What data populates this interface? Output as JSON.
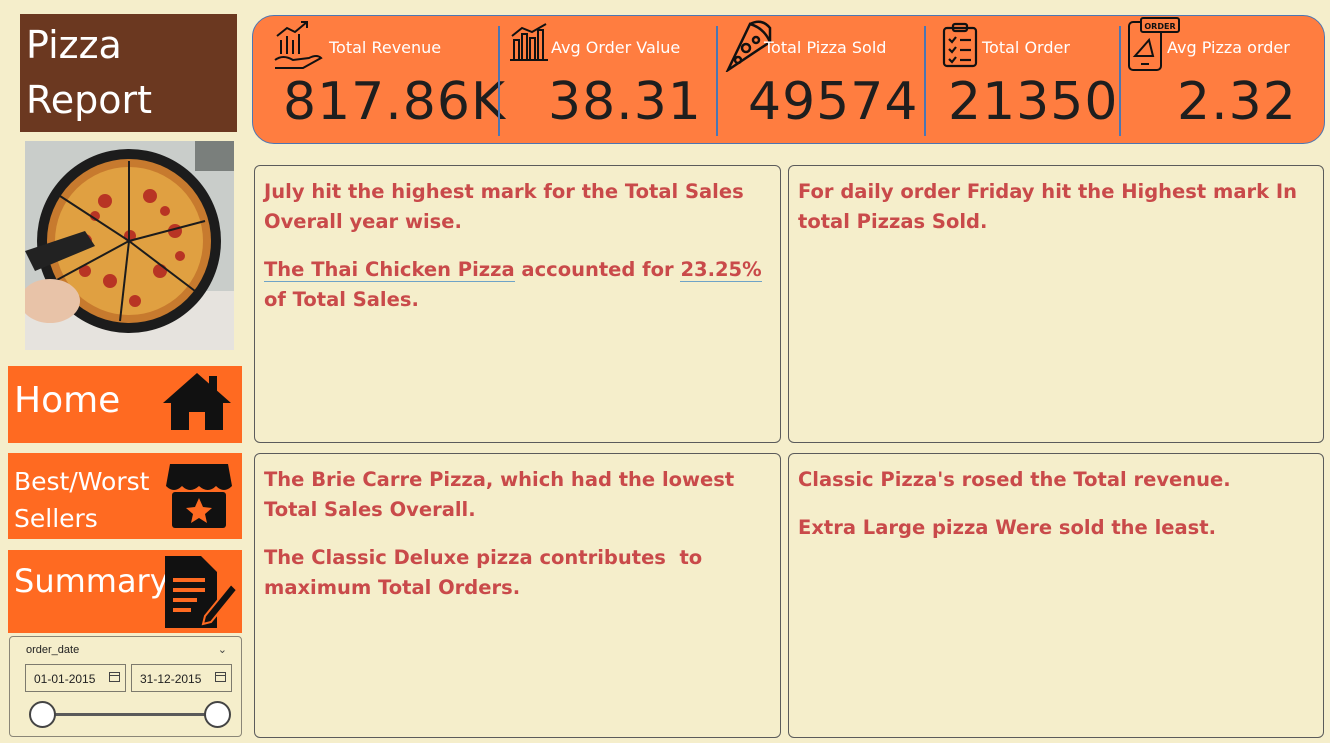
{
  "title": {
    "line1": "Pizza",
    "line2": "Report"
  },
  "nav": {
    "home": "Home",
    "best_worst": "Best/Worst Sellers",
    "summary": "Summary"
  },
  "slicer": {
    "field": "order_date",
    "start": "01-01-2015",
    "end": "31-12-2015"
  },
  "kpis": [
    {
      "label": "Total Revenue",
      "value": "817.86K",
      "icon": "revenue-chart-icon"
    },
    {
      "label": "Avg Order Value",
      "value": "38.31",
      "icon": "bar-chart-icon"
    },
    {
      "label": "Total Pizza Sold",
      "value": "49574",
      "icon": "pizza-slice-icon"
    },
    {
      "label": "Total Order",
      "value": "21350",
      "icon": "clipboard-checklist-icon"
    },
    {
      "label": "Avg Pizza order",
      "value": "2.32",
      "icon": "phone-order-icon"
    }
  ],
  "insights": {
    "p1": {
      "line1": "July hit the highest mark for the Total Sales Overall year wise.",
      "line2_a": "The Thai Chicken Pizza",
      "line2_b": " accounted for ",
      "line2_c": "23.25%",
      "line2_d": " of Total Sales."
    },
    "p2": {
      "line1": "For daily order Friday hit the Highest mark In total Pizzas Sold."
    },
    "p3": {
      "line1": "The Brie Carre Pizza, which had the lowest Total Sales Overall.",
      "line2": "The Classic Deluxe pizza contributes  to maximum Total Orders."
    },
    "p4": {
      "line1": "Classic Pizza's rosed the Total revenue.",
      "line2": "Extra Large pizza Were sold the least."
    }
  },
  "colors": {
    "background": "#f5eecb",
    "title_bg": "#6b3820",
    "nav_bg": "#ff6a21",
    "kpi_bg": "#ff7d40",
    "insight_text": "#c94a4a",
    "divider": "#4b76b3"
  }
}
